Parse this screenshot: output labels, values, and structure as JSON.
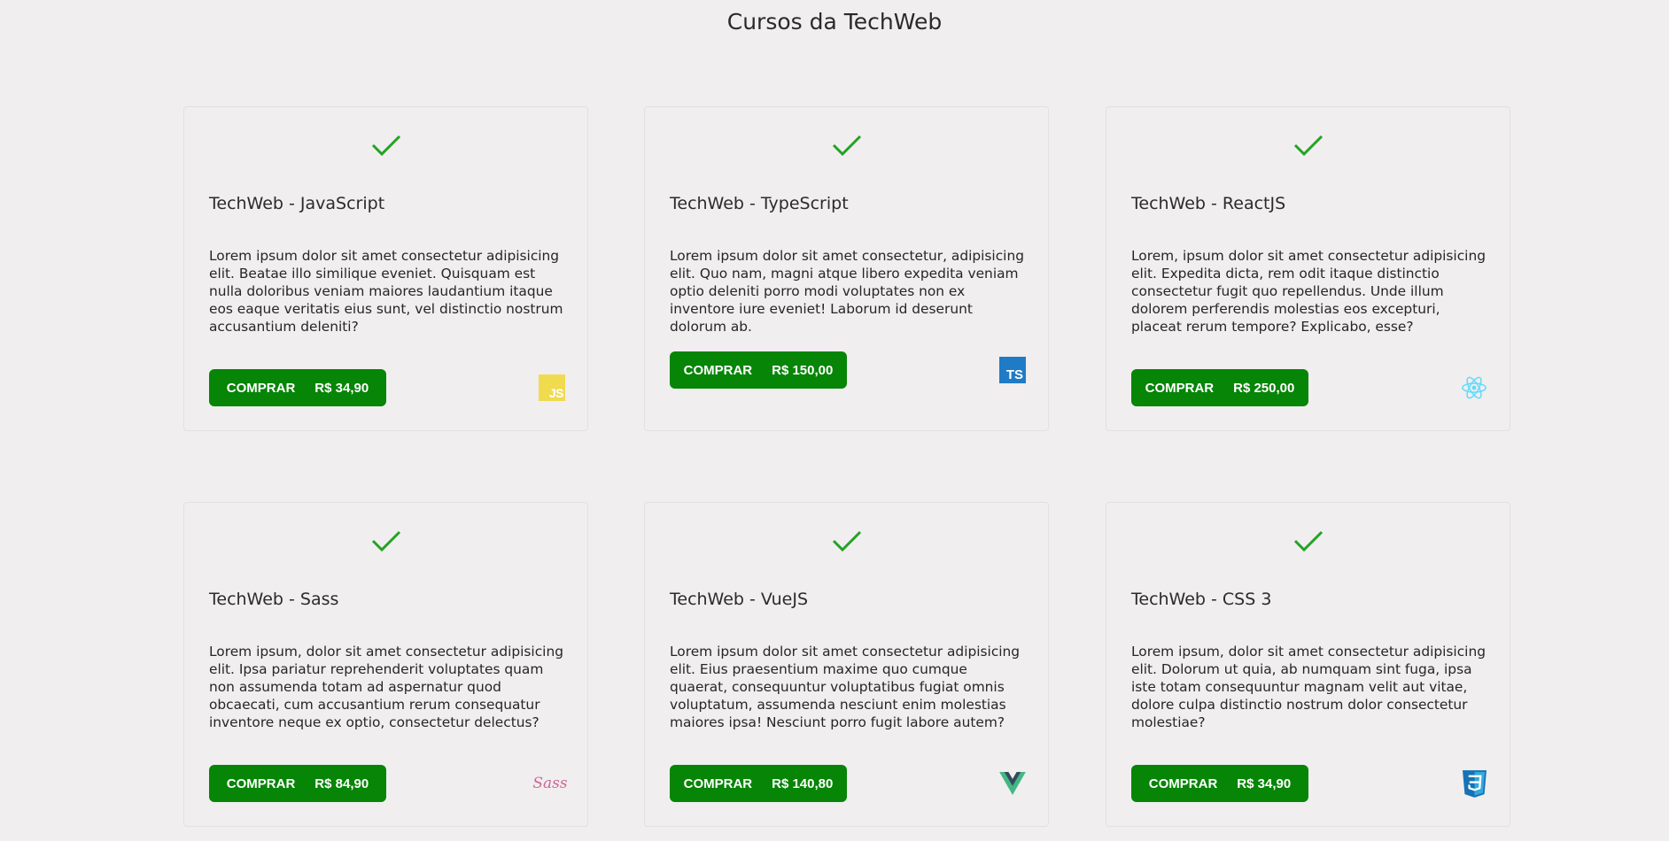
{
  "page": {
    "title": "Cursos da TechWeb"
  },
  "courses": [
    {
      "title": "TechWeb - JavaScript",
      "description": "Lorem ipsum dolor sit amet consectetur adipisicing elit. Beatae illo similique eveniet. Quisquam est nulla doloribus veniam maiores laudantium itaque eos eaque veritatis eius sunt, vel distinctio nostrum accusantium deleniti?",
      "button_label": "COMPRAR",
      "price": "R$ 34,90",
      "logo": "javascript-logo",
      "logo_text": "JS"
    },
    {
      "title": "TechWeb - TypeScript",
      "description": "Lorem ipsum dolor sit amet consectetur, adipisicing elit. Quo nam, magni atque libero expedita veniam optio deleniti porro modi voluptates non ex inventore iure eveniet! Laborum id deserunt dolorum ab.",
      "button_label": "COMPRAR",
      "price": "R$ 150,00",
      "logo": "typescript-logo",
      "logo_text": "TS"
    },
    {
      "title": "TechWeb - ReactJS",
      "description": "Lorem, ipsum dolor sit amet consectetur adipisicing elit. Expedita dicta, rem odit itaque distinctio consectetur fugit quo repellendus. Unde illum dolorem perferendis molestias eos excepturi, placeat rerum tempore? Explicabo, esse?",
      "button_label": "COMPRAR",
      "price": "R$ 250,00",
      "logo": "react-logo"
    },
    {
      "title": "TechWeb - Sass",
      "description": "Lorem ipsum, dolor sit amet consectetur adipisicing elit. Ipsa pariatur reprehenderit voluptates quam non assumenda totam ad aspernatur quod obcaecati, cum accusantium rerum consequatur inventore neque ex optio, consectetur delectus?",
      "button_label": "COMPRAR",
      "price": "R$ 84,90",
      "logo": "sass-logo",
      "logo_text": "Sass"
    },
    {
      "title": "TechWeb - VueJS",
      "description": "Lorem ipsum dolor sit amet consectetur adipisicing elit. Eius praesentium maxime quo cumque quaerat, consequuntur voluptatibus fugiat omnis voluptatum, assumenda nesciunt enim molestias maiores ipsa! Nesciunt porro fugit labore autem?",
      "button_label": "COMPRAR",
      "price": "R$ 140,80",
      "logo": "vue-logo"
    },
    {
      "title": "TechWeb - CSS 3",
      "description": "Lorem ipsum, dolor sit amet consectetur adipisicing elit. Dolorum ut quia, ab numquam sint fuga, ipsa iste totam consequuntur magnam velit aut vitae, dolore culpa distinctio nostrum dolor consectetur molestiae?",
      "button_label": "COMPRAR",
      "price": "R$ 34,90",
      "logo": "css3-logo"
    }
  ],
  "colors": {
    "background": "#f0eeef",
    "button": "#068506",
    "check": "#22a322"
  }
}
